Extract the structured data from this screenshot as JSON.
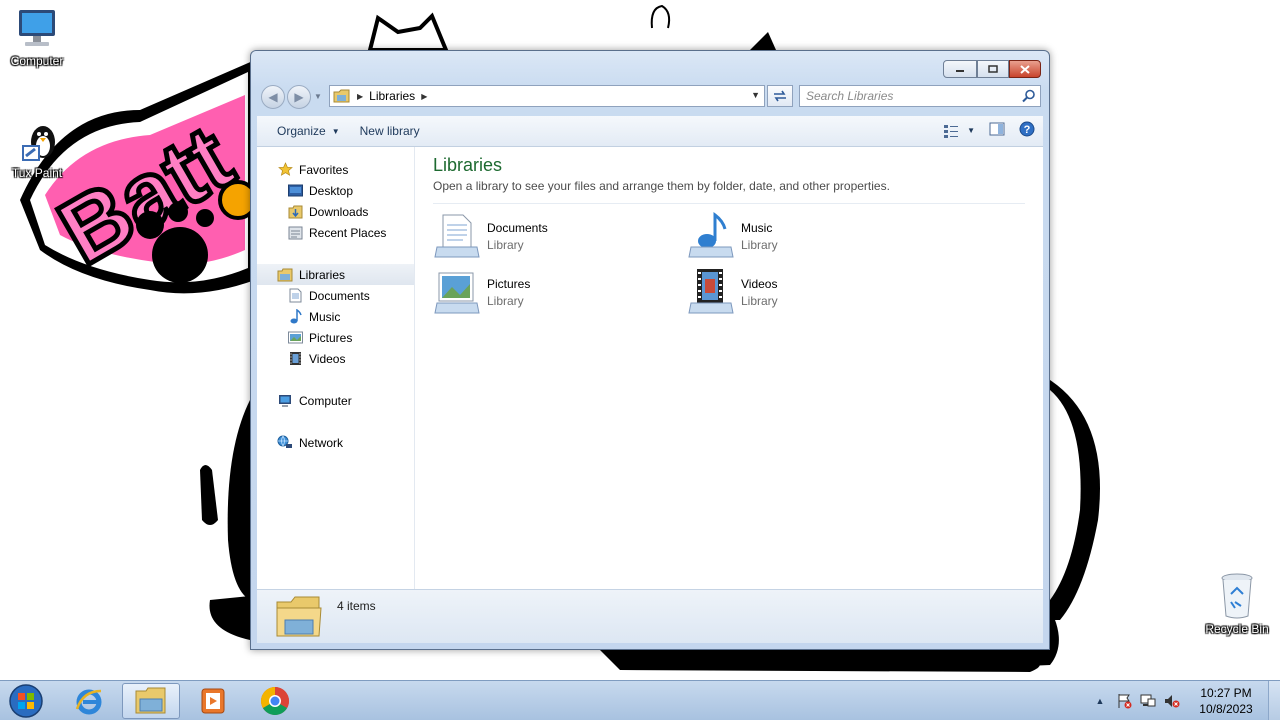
{
  "desktop": {
    "icons": [
      {
        "name": "computer",
        "label": "Computer",
        "icon": "computer-icon"
      },
      {
        "name": "tux-paint",
        "label": "Tux Paint",
        "icon": "tux-paint-icon"
      },
      {
        "name": "recycle-bin",
        "label": "Recycle Bin",
        "icon": "recycle-bin-icon"
      }
    ]
  },
  "window": {
    "address": {
      "crumb": "Libraries"
    },
    "search": {
      "placeholder": "Search Libraries"
    },
    "toolbar": {
      "organize_label": "Organize",
      "new_library_label": "New library"
    },
    "navpane": {
      "favorites": "Favorites",
      "desktop": "Desktop",
      "downloads": "Downloads",
      "recent_places": "Recent Places",
      "libraries": "Libraries",
      "documents": "Documents",
      "music": "Music",
      "pictures": "Pictures",
      "videos": "Videos",
      "computer": "Computer",
      "network": "Network"
    },
    "content": {
      "title": "Libraries",
      "subtitle": "Open a library to see your files and arrange them by folder, date, and other properties.",
      "libraries": [
        {
          "name": "Documents",
          "type": "Library"
        },
        {
          "name": "Music",
          "type": "Library"
        },
        {
          "name": "Pictures",
          "type": "Library"
        },
        {
          "name": "Videos",
          "type": "Library"
        }
      ]
    },
    "status": {
      "count": "4 items"
    }
  },
  "taskbar": {
    "items": [
      "start-orb",
      "internet-explorer",
      "windows-explorer",
      "media-player",
      "chrome"
    ],
    "clock": {
      "time": "10:27 PM",
      "date": "10/8/2023"
    }
  },
  "colors": {
    "title_green": "#1d6a30",
    "taskbar": "#b7cde6",
    "link_blue": "#1e395b"
  }
}
